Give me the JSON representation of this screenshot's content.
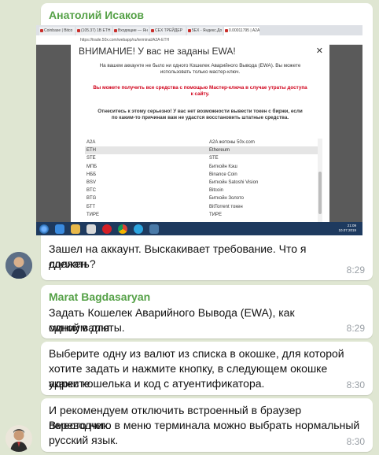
{
  "messages": [
    {
      "sender": "Анатолий Исаков",
      "line1": "Зашел на аккаунт. Выскакивает требование. Что я должен",
      "line2": "сделать?",
      "time": "8:29"
    },
    {
      "sender": "Marat Bagdasaryan",
      "line1": "Задать Кошелек Аварийного Вывода (EWA), как миниум для",
      "line2": "одной валюты.",
      "time": "8:29"
    },
    {
      "line1": "Выберите одну из валют из списка в окошке, для которой",
      "line2": "хотите задать и нажмите кнопку, в следующем окошке укажите",
      "line3": "адрес кошелька и код с атуентификатора.",
      "time": "8:30"
    },
    {
      "line1": "И рекомендуем отключить встроенный в браузер переводчик.",
      "line2": "Вместо него в меню терминала можно выбрать нормальный",
      "line3": "русский язык.",
      "time": "8:30"
    }
  ],
  "screenshot": {
    "tabs": [
      "Coinbase | Bitco",
      "(105.37) 1B ETH",
      "Входящие — Ян",
      "СЕХ ТРЕЙДЕР",
      "5EX - Яндекс.До",
      "0.00011795 | A2A"
    ],
    "address": "https://trade.50x.com/webapp/ru/terminal/A2A-ETH",
    "dialog": {
      "title": "ВНИМАНИЕ! У вас не заданы EWA!",
      "close": "✕",
      "p1a": "На вашем аккаунте не было ни одного Кошелек Аварийного Вывода (EWA). Вы можете",
      "p1b": "использовать только мастер-ключ.",
      "p2a": "Вы можете получить все средства с помощью Мастер-ключа в случае утраты доступа",
      "p2b": "к сайту.",
      "p3a": "Отнеситесь к этому серьезно! У вас нет возможности вывести токен с биржи, если",
      "p3b": "по каким-то причинам вам не удастся восстановить штатные средства.",
      "rows": [
        {
          "code": "A2A",
          "name": "A2A жетоны 50x.com"
        },
        {
          "code": "ETH",
          "name": "Ethereum"
        },
        {
          "code": "STE",
          "name": "STE"
        },
        {
          "code": "МПБ",
          "name": "Биткойн Кэш"
        },
        {
          "code": "НББ",
          "name": "Binance Coin"
        },
        {
          "code": "BSV",
          "name": "Биткойн Satoshi Vision"
        },
        {
          "code": "BTC",
          "name": "Bitcoin"
        },
        {
          "code": "BTG",
          "name": "Биткойн Золото"
        },
        {
          "code": "БТТ",
          "name": "BitTorrent токен"
        },
        {
          "code": "ТИРЕ",
          "name": "ТИРЕ"
        }
      ],
      "selected_row": 1
    },
    "clock_time": "21:09",
    "clock_date": "10.07.2019"
  },
  "colors": {
    "background": "#dfe6d2",
    "sender_name": "#55a147",
    "timestamp": "#9aa0a6"
  }
}
